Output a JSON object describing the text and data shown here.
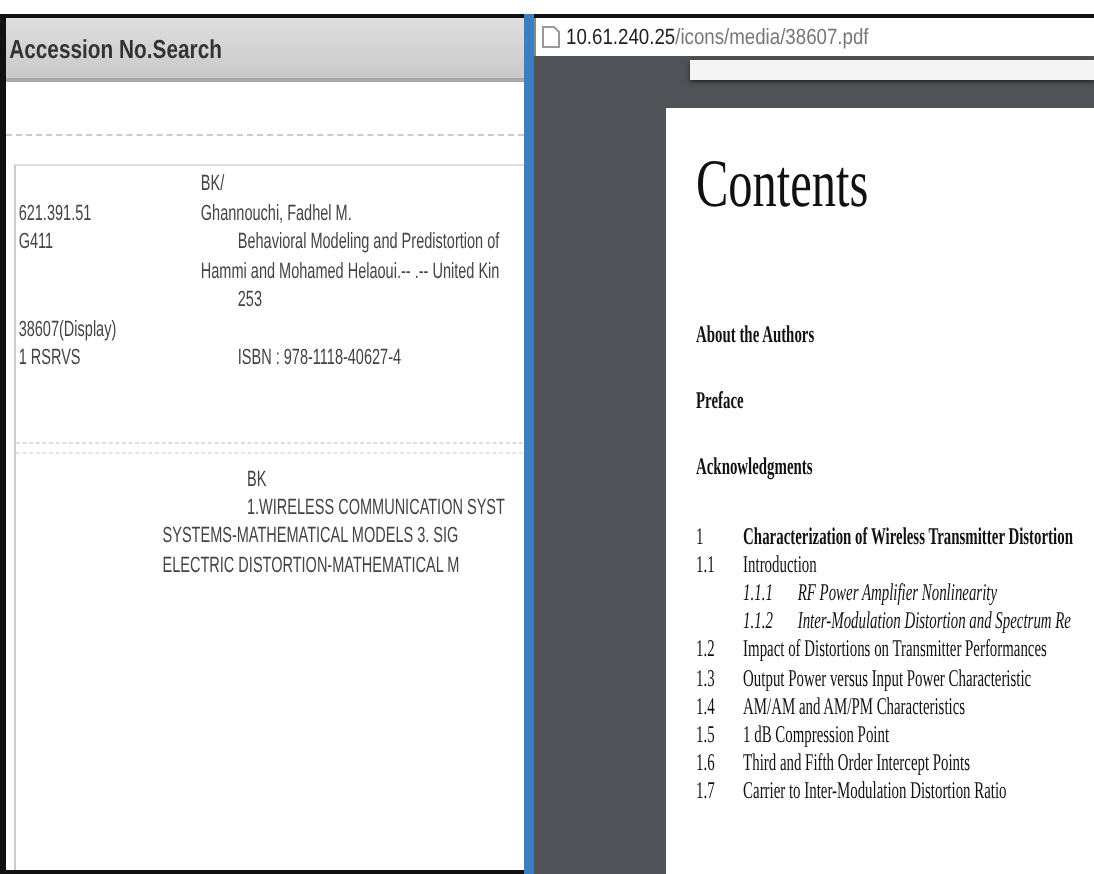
{
  "search_panel": {
    "title": "Accession No.Search",
    "record_rows": [
      {
        "text": "BK/",
        "kind": "flush"
      },
      {
        "call": "621.391.51",
        "text": "Ghannouchi, Fadhel M.",
        "kind": "flush"
      },
      {
        "call": "G411",
        "text": "Behavioral Modeling and Predistortion of",
        "kind": "indent"
      },
      {
        "text": "Hammi and Mohamed Helaoui.-- .-- United Kin",
        "kind": "flush"
      },
      {
        "text": "253",
        "kind": "indent"
      },
      {
        "call": "38607(Display)",
        "kind": "flush"
      },
      {
        "call": "1 RSRVS",
        "text": "ISBN : 978-1118-40627-4",
        "kind": "indent"
      }
    ],
    "subjects": {
      "heading": "BK",
      "lines": [
        {
          "text": "1.WIRELESS COMMUNICATION SYST",
          "kind": "indent"
        },
        {
          "text": "SYSTEMS-MATHEMATICAL MODELS 3. SIG",
          "kind": "flush"
        },
        {
          "text": "ELECTRIC DISTORTION-MATHEMATICAL M",
          "kind": "flush"
        }
      ]
    }
  },
  "pdf_viewer": {
    "address": {
      "host": "10.61.240.25",
      "path": "/icons/media/38607.pdf"
    },
    "heading": "Contents",
    "front_matter": [
      "About the Authors",
      "Preface",
      "Acknowledgments"
    ],
    "entries": [
      {
        "number": "1",
        "title": "Characterization of Wireless Transmitter Distortion",
        "kind": "chapter"
      },
      {
        "number": "1.1",
        "title": "Introduction",
        "kind": "section"
      },
      {
        "number": "1.1.1",
        "title": "RF Power Amplifier Nonlinearity",
        "kind": "subsection"
      },
      {
        "number": "1.1.2",
        "title": "Inter-Modulation Distortion and Spectrum Re",
        "kind": "subsection"
      },
      {
        "number": "1.2",
        "title": "Impact of Distortions on Transmitter Performances",
        "kind": "section"
      },
      {
        "number": "1.3",
        "title": "Output Power versus Input Power Characteristic",
        "kind": "section"
      },
      {
        "number": "1.4",
        "title": "AM/AM and AM/PM Characteristics",
        "kind": "section"
      },
      {
        "number": "1.5",
        "title": "1 dB Compression Point",
        "kind": "section"
      },
      {
        "number": "1.6",
        "title": "Third and Fifth Order Intercept Points",
        "kind": "section"
      },
      {
        "number": "1.7",
        "title": "Carrier to Inter-Modulation Distortion Ratio",
        "kind": "section"
      }
    ]
  }
}
